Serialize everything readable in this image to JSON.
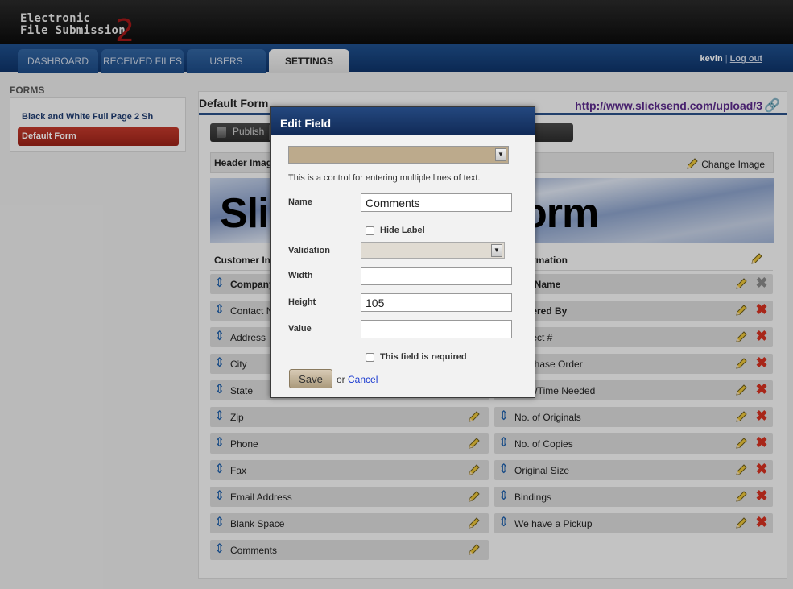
{
  "app": {
    "logo_line1": "Electronic",
    "logo_line2": "File Submission",
    "logo_number": "2"
  },
  "nav": {
    "tabs": [
      {
        "label": "DASHBOARD"
      },
      {
        "label": "RECEIVED FILES"
      },
      {
        "label": "USERS"
      },
      {
        "label": "SETTINGS",
        "active": true
      }
    ],
    "user": "kevin",
    "separator": "|",
    "logout": "Log out"
  },
  "sidebar": {
    "title": "FORMS",
    "items": [
      {
        "label": "Black and White Full Page 2 Sh"
      },
      {
        "label": "Default Form",
        "active": true
      }
    ]
  },
  "main": {
    "title": "Default Form",
    "url": "http://www.slicksend.com/upload/3",
    "publish_label": "Publish",
    "header_image_label": "Header Image",
    "change_image_label": "Change Image",
    "header_image_text_left": "Slic",
    "header_image_text_right": "orm",
    "left_section_title": "Customer Information",
    "right_section_title": "Information",
    "left_fields": [
      {
        "label": "Company",
        "bold": true
      },
      {
        "label": "Contact Name"
      },
      {
        "label": "Address"
      },
      {
        "label": "City"
      },
      {
        "label": "State"
      },
      {
        "label": "Zip"
      },
      {
        "label": "Phone"
      },
      {
        "label": "Fax"
      },
      {
        "label": "Email Address"
      },
      {
        "label": "Blank Space"
      },
      {
        "label": "Comments"
      }
    ],
    "right_fields": [
      {
        "label": "Job Name",
        "bold": true,
        "delete_disabled": true
      },
      {
        "label": "Ordered By",
        "bold": true
      },
      {
        "label": "Project #"
      },
      {
        "label": "Purchase Order"
      },
      {
        "label": "Date/Time Needed"
      },
      {
        "label": "No. of Originals"
      },
      {
        "label": "No. of Copies"
      },
      {
        "label": "Original Size"
      },
      {
        "label": "Bindings"
      },
      {
        "label": "We have a Pickup"
      }
    ]
  },
  "modal": {
    "title": "Edit Field",
    "description": "This is a control for entering multiple lines of text.",
    "name_label": "Name",
    "name_value": "Comments",
    "hide_label": "Hide Label",
    "validation_label": "Validation",
    "width_label": "Width",
    "width_value": "",
    "height_label": "Height",
    "height_value": "105",
    "value_label": "Value",
    "value_value": "",
    "required_label": "This field is required",
    "save_label": "Save",
    "or_text": "or",
    "cancel_label": "Cancel"
  },
  "colors": {
    "nav": "#1f4f8c",
    "active_form": "#b02e22",
    "modal_head": "#1a3a6e",
    "url": "#5a2a8a"
  }
}
